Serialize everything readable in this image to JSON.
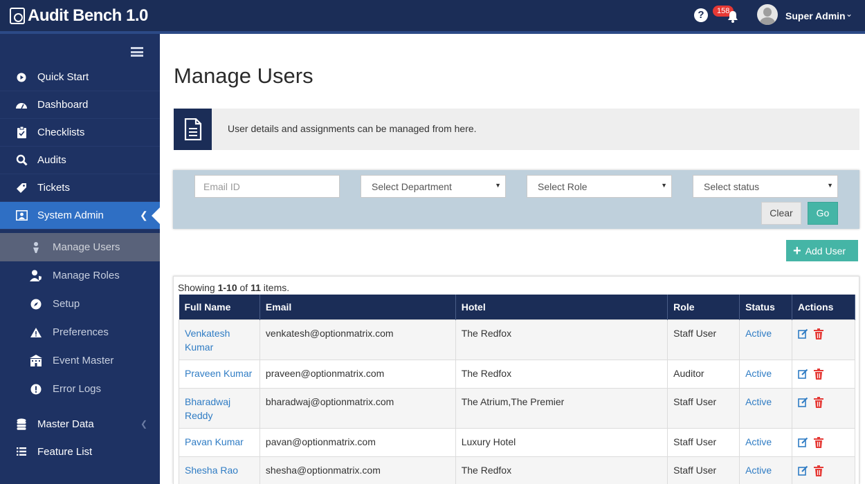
{
  "app": {
    "title": "Audit Bench 1.0",
    "notification_count": "158",
    "user_name": "Super Admin"
  },
  "sidebar": {
    "items": [
      {
        "label": "Quick Start",
        "icon": "play-circle-icon"
      },
      {
        "label": "Dashboard",
        "icon": "dashboard-gauge-icon"
      },
      {
        "label": "Checklists",
        "icon": "clipboard-icon"
      },
      {
        "label": "Audits",
        "icon": "search-icon"
      },
      {
        "label": "Tickets",
        "icon": "tag-icon"
      },
      {
        "label": "System Admin",
        "icon": "admin-icon"
      }
    ],
    "sub_items": [
      {
        "label": "Manage Users",
        "icon": "user-icon"
      },
      {
        "label": "Manage Roles",
        "icon": "user-shield-icon"
      },
      {
        "label": "Setup",
        "icon": "compass-icon"
      },
      {
        "label": "Preferences",
        "icon": "warning-triangle-icon"
      },
      {
        "label": "Event Master",
        "icon": "building-icon"
      },
      {
        "label": "Error Logs",
        "icon": "exclamation-circle-icon"
      }
    ],
    "bottom_items": [
      {
        "label": "Master Data",
        "icon": "database-icon"
      },
      {
        "label": "Feature List",
        "icon": "list-icon"
      }
    ]
  },
  "page": {
    "title": "Manage Users",
    "info_text": "User details and assignments can be managed from here."
  },
  "filters": {
    "email_placeholder": "Email ID",
    "department": "Select Department",
    "role": "Select Role",
    "status": "Select status",
    "clear_label": "Clear",
    "go_label": "Go"
  },
  "add_user_label": "Add User",
  "grid": {
    "summary_prefix": "Showing ",
    "summary_range": "1-10",
    "summary_mid": " of ",
    "summary_total": "11",
    "summary_suffix": " items.",
    "columns": [
      "Full Name",
      "Email",
      "Hotel",
      "Role",
      "Status",
      "Actions"
    ],
    "rows": [
      {
        "name": "Venkatesh Kumar",
        "email": "venkatesh@optionmatrix.com",
        "hotel": "The Redfox",
        "role": "Staff User",
        "status": "Active"
      },
      {
        "name": "Praveen Kumar",
        "email": "praveen@optionmatrix.com",
        "hotel": "The Redfox",
        "role": "Auditor",
        "status": "Active"
      },
      {
        "name": "Bharadwaj Reddy",
        "email": "bharadwaj@optionmatrix.com",
        "hotel": "The Atrium,The Premier",
        "role": "Staff User",
        "status": "Active"
      },
      {
        "name": "Pavan Kumar",
        "email": "pavan@optionmatrix.com",
        "hotel": "Luxury Hotel",
        "role": "Staff User",
        "status": "Active"
      },
      {
        "name": "Shesha Rao",
        "email": "shesha@optionmatrix.com",
        "hotel": "The Redfox",
        "role": "Staff User",
        "status": "Active"
      }
    ]
  },
  "colors": {
    "topbar": "#1b2d57",
    "sidebar": "#1e3263",
    "active_nav": "#2f6fc4",
    "accent_teal": "#45b5a6",
    "link": "#2f7cc4",
    "delete": "#e53935"
  }
}
